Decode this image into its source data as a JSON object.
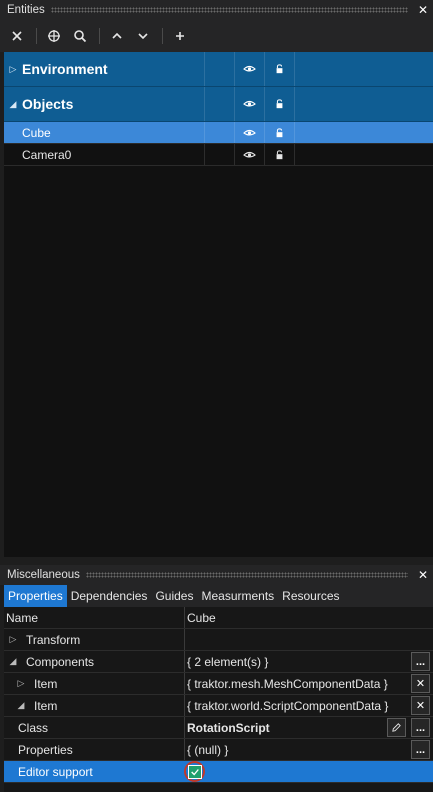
{
  "entities_panel": {
    "title": "Entities",
    "toolbar": [
      {
        "icon": "close-icon"
      },
      {
        "icon": "crosshair-icon"
      },
      {
        "icon": "search-icon"
      },
      {
        "icon": "chevron-up-icon"
      },
      {
        "icon": "chevron-down-icon"
      },
      {
        "icon": "plus-icon"
      }
    ],
    "groups": [
      {
        "label": "Environment",
        "expanded": false
      },
      {
        "label": "Objects",
        "expanded": true
      }
    ],
    "items": [
      {
        "label": "Cube",
        "selected": true
      },
      {
        "label": "Camera0",
        "selected": false
      }
    ]
  },
  "misc_panel": {
    "title": "Miscellaneous",
    "tabs": [
      "Properties",
      "Dependencies",
      "Guides",
      "Measurments",
      "Resources"
    ],
    "active_tab": "Properties",
    "header": {
      "name": "Name",
      "value": "Cube"
    },
    "rows": [
      {
        "name": "Transform",
        "value": ""
      },
      {
        "name": "Components",
        "value": "{ 2 element(s) }"
      },
      {
        "name": "Item",
        "value": "{ traktor.mesh.MeshComponentData }"
      },
      {
        "name": "Item",
        "value": "{ traktor.world.ScriptComponentData }"
      },
      {
        "name": "Class",
        "value": "RotationScript"
      },
      {
        "name": "Properties",
        "value": "{ (null) }"
      },
      {
        "name": "Editor support",
        "value": "",
        "checked": true
      }
    ],
    "ellipsis_label": "..."
  },
  "colors": {
    "group_bg": "#0f5d93",
    "selected_row": "#3c88d8",
    "active_tab": "#1e78d2",
    "checkbox": "#20a06e",
    "highlight_ring": "#c0392b"
  }
}
